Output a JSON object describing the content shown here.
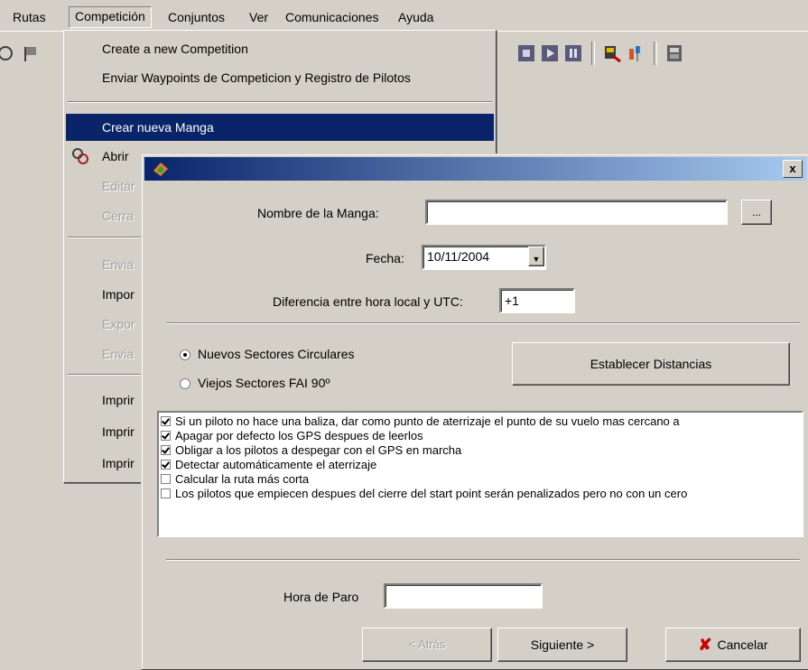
{
  "menubar": {
    "items": [
      "Rutas",
      "Competición",
      "Conjuntos",
      "Ver",
      "Comunicaciones",
      "Ayuda"
    ]
  },
  "dropdown": {
    "items": [
      {
        "label": "Create a new Competition",
        "state": "normal"
      },
      {
        "label": "Enviar Waypoints de Competicion y Registro de Pilotos",
        "state": "normal"
      },
      {
        "label": "Crear nueva Manga",
        "state": "selected"
      },
      {
        "label": "Abrir",
        "state": "normal"
      },
      {
        "label": "Editar",
        "state": "disabled"
      },
      {
        "label": "Cerra",
        "state": "disabled"
      },
      {
        "label": "Envia",
        "state": "disabled"
      },
      {
        "label": "Impor",
        "state": "normal"
      },
      {
        "label": "Expor",
        "state": "disabled"
      },
      {
        "label": "Envia",
        "state": "disabled"
      },
      {
        "label": "Imprir",
        "state": "normal"
      },
      {
        "label": "Imprir",
        "state": "normal"
      },
      {
        "label": "Imprir",
        "state": "normal"
      }
    ]
  },
  "dialog": {
    "close_symbol": "x",
    "nombre_label": "Nombre de la Manga:",
    "nombre_value": "",
    "browse_label": "...",
    "fecha_label": "Fecha:",
    "fecha_value": "10/11/2004",
    "diferencia_label": "Diferencia entre hora local y UTC:",
    "diferencia_value": "+1",
    "radio_nuevos": "Nuevos Sectores Circulares",
    "radio_viejos": "Viejos Sectores FAI 90º",
    "radio_selected": "nuevos",
    "establecer_label": "Establecer Distancias",
    "options": [
      {
        "label": "Si un piloto no hace una baliza, dar como punto de aterrizaje el punto de su vuelo mas cercano a",
        "checked": true
      },
      {
        "label": "Apagar por defecto los GPS despues de leerlos",
        "checked": true
      },
      {
        "label": "Obligar a los pilotos a despegar con el GPS en marcha",
        "checked": true
      },
      {
        "label": "Detectar automáticamente el aterrizaje",
        "checked": true
      },
      {
        "label": "Calcular la ruta más corta",
        "checked": false
      },
      {
        "label": "Los pilotos que empiecen despues del cierre del start point serán penalizados pero no con un cero",
        "checked": false
      }
    ],
    "hora_paro_label": "Hora de Paro",
    "hora_paro_value": "",
    "atras_label": "< Atrás",
    "siguiente_label": "Siguiente >",
    "cancelar_label": "Cancelar"
  },
  "colors": {
    "face": "#d4d0c8",
    "selection": "#0a246a",
    "cancel_icon": "#cc0000"
  }
}
